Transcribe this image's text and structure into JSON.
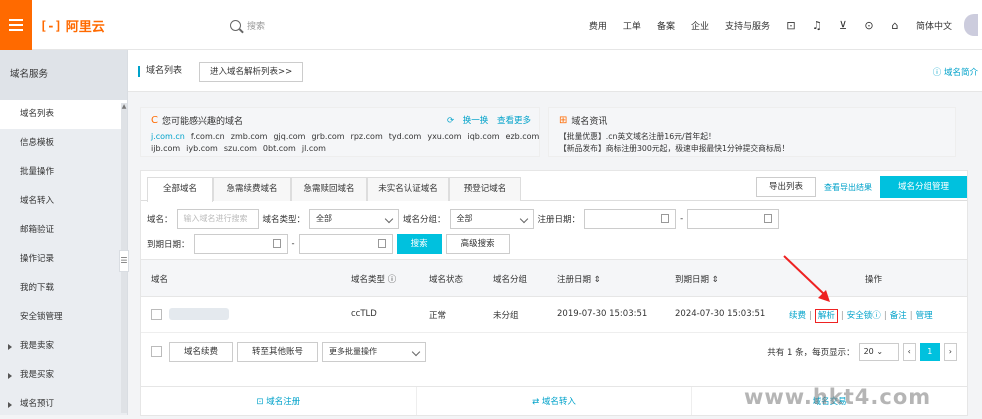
{
  "header": {
    "logo_text": "阿里云",
    "search_placeholder": "搜索",
    "nav": [
      "费用",
      "工单",
      "备案",
      "企业",
      "支持与服务"
    ],
    "lang": "简体中文",
    "icons": [
      "terminal-icon",
      "bell-icon",
      "cart-icon",
      "help-icon",
      "home-icon"
    ]
  },
  "sidebar": {
    "title": "域名服务",
    "items": [
      {
        "label": "域名列表",
        "active": true
      },
      {
        "label": "信息模板"
      },
      {
        "label": "批量操作"
      },
      {
        "label": "域名转入"
      },
      {
        "label": "邮箱验证"
      },
      {
        "label": "操作记录"
      },
      {
        "label": "我的下载"
      },
      {
        "label": "安全锁管理"
      },
      {
        "label": "我是卖家",
        "group": true
      },
      {
        "label": "我是买家",
        "group": true
      },
      {
        "label": "域名预订",
        "group": true
      }
    ]
  },
  "breadcrumb": {
    "title": "域名列表",
    "enter_btn": "进入域名解析列表>>",
    "intro": "域名简介"
  },
  "interest": {
    "title": "您可能感兴趣的域名",
    "refresh": "换一换",
    "more": "查看更多",
    "row1": [
      "j.com.cn",
      "f.com.cn",
      "zmb.com",
      "gjq.com",
      "grb.com",
      "rpz.com",
      "tyd.com",
      "yxu.com",
      "iqb.com",
      "ezb.com"
    ],
    "row2": [
      "ijb.com",
      "iyb.com",
      "szu.com",
      "0bt.com",
      "jl.com"
    ]
  },
  "news": {
    "title": "域名资讯",
    "line1": "【批量优惠】.cn英文域名注册16元/首年起！",
    "line2": "【新品发布】商标注册300元起，极速申报最快1分钟提交商标局！"
  },
  "tabs": [
    "全部域名",
    "急需续费域名",
    "急需赎回域名",
    "未实名认证域名",
    "预登记域名"
  ],
  "tab_actions": {
    "export_list": "导出列表",
    "export_result": "查看导出结果",
    "group_manage": "域名分组管理"
  },
  "filters": {
    "domain_label": "域名：",
    "domain_placeholder": "输入域名进行搜索",
    "type_label": "域名类型：",
    "type_value": "全部",
    "group_label": "域名分组：",
    "group_value": "全部",
    "reg_date_label": "注册日期：",
    "dash": "-",
    "expire_label": "到期日期：",
    "search_btn": "搜索",
    "adv_btn": "高级搜索"
  },
  "table": {
    "headers": {
      "domain": "域名",
      "type": "域名类型",
      "status": "域名状态",
      "group": "域名分组",
      "reg": "注册日期",
      "expire": "到期日期",
      "ops": "操作"
    },
    "rows": [
      {
        "type": "ccTLD",
        "status": "正常",
        "group": "未分组",
        "reg": "2019-07-30 15:03:51",
        "expire": "2024-07-30 15:03:51",
        "ops": [
          "续费",
          "解析",
          "安全锁",
          "备注",
          "管理"
        ]
      }
    ]
  },
  "bottom": {
    "renew_btn": "域名续费",
    "transfer_btn": "转至其他账号",
    "more_ops": "更多批量操作",
    "total_text": "共有 1 条，每页显示：",
    "page_size": "20",
    "current_page": "1"
  },
  "shortcuts": [
    "域名注册",
    "域名转入",
    "域名交易"
  ],
  "watermark": "www.hkt4.com",
  "accent_color": "#00c1de",
  "brand_color": "#ff6a00"
}
